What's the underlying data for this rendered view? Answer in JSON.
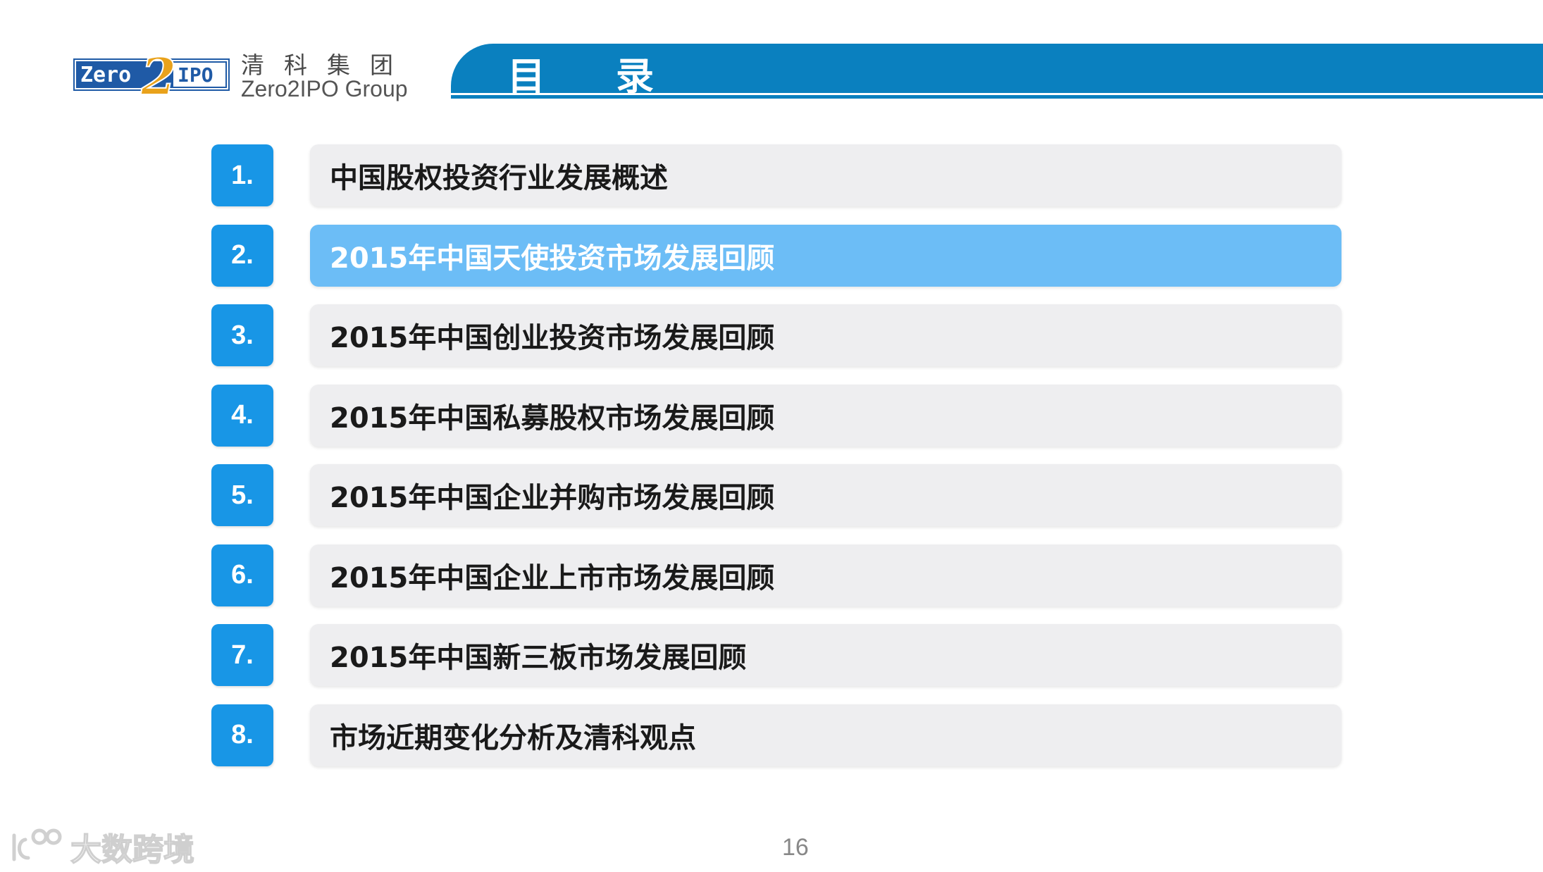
{
  "header": {
    "logo": {
      "mark_left": "Zero",
      "mark_right": "IPO",
      "mark_digit": "2",
      "name_cn": "清科集团",
      "name_en": "Zero2IPO Group"
    },
    "title": "目录"
  },
  "toc": {
    "items": [
      {
        "num": "1.",
        "label": "中国股权投资行业发展概述"
      },
      {
        "num": "2.",
        "label": "2015年中国天使投资市场发展回顾"
      },
      {
        "num": "3.",
        "label": "2015年中国创业投资市场发展回顾"
      },
      {
        "num": "4.",
        "label": "2015年中国私募股权市场发展回顾"
      },
      {
        "num": "5.",
        "label": "2015年中国企业并购市场发展回顾"
      },
      {
        "num": "6.",
        "label": "2015年中国企业上市市场发展回顾"
      },
      {
        "num": "7.",
        "label": "2015年中国新三板市场发展回顾"
      },
      {
        "num": "8.",
        "label": "市场近期变化分析及清科观点"
      }
    ],
    "active_index": 1
  },
  "footer": {
    "page_number": "16",
    "watermark": "大数跨境"
  },
  "colors": {
    "brand_blue": "#0a80bf",
    "number_box": "#1896e6",
    "active_item": "#6cbdf6",
    "inactive_item": "#eeeef0"
  }
}
